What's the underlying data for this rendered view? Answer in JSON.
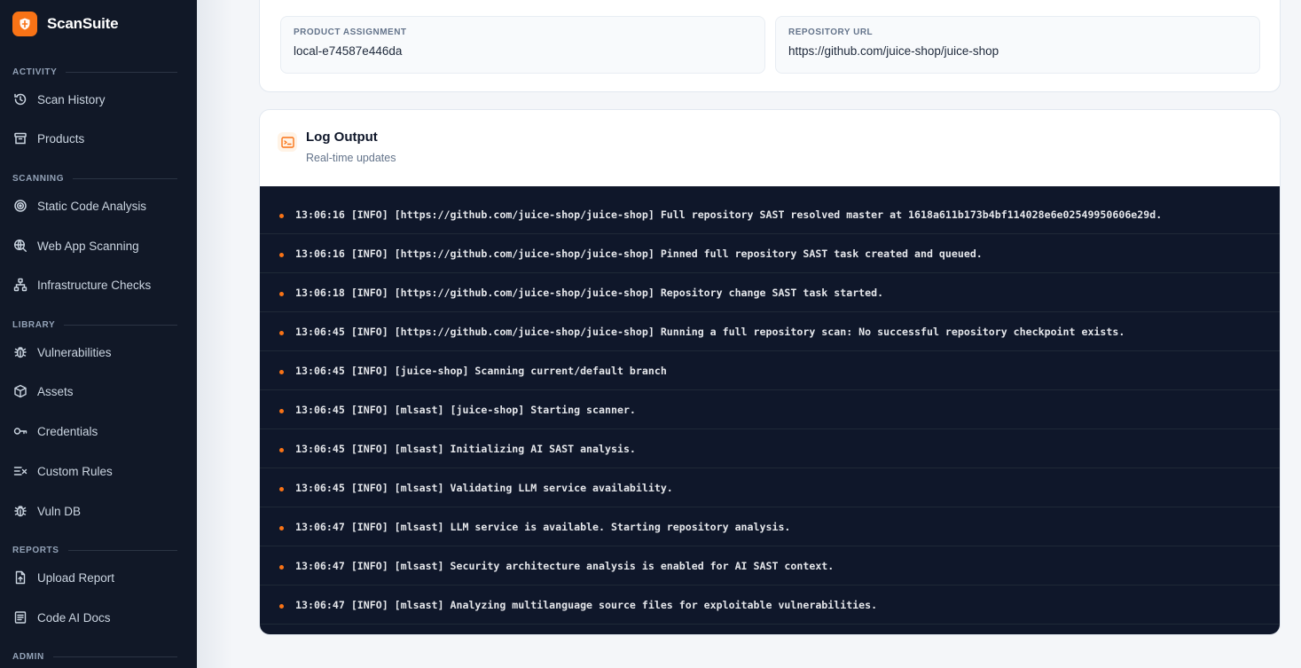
{
  "app": {
    "name": "ScanSuite"
  },
  "sidebar": {
    "sections": [
      {
        "title": "ACTIVITY",
        "items": [
          {
            "label": "Scan History",
            "icon": "history-icon"
          },
          {
            "label": "Products",
            "icon": "archive-icon"
          }
        ]
      },
      {
        "title": "SCANNING",
        "items": [
          {
            "label": "Static Code Analysis",
            "icon": "target-icon"
          },
          {
            "label": "Web App Scanning",
            "icon": "globe-search-icon"
          },
          {
            "label": "Infrastructure Checks",
            "icon": "network-icon"
          }
        ]
      },
      {
        "title": "LIBRARY",
        "items": [
          {
            "label": "Vulnerabilities",
            "icon": "bug-icon"
          },
          {
            "label": "Assets",
            "icon": "box-icon"
          },
          {
            "label": "Credentials",
            "icon": "key-icon"
          },
          {
            "label": "Custom Rules",
            "icon": "list-x-icon"
          },
          {
            "label": "Vuln DB",
            "icon": "bug-icon"
          }
        ]
      },
      {
        "title": "REPORTS",
        "items": [
          {
            "label": "Upload Report",
            "icon": "file-upload-icon"
          },
          {
            "label": "Code AI Docs",
            "icon": "document-icon"
          }
        ]
      },
      {
        "title": "ADMIN",
        "items": []
      }
    ]
  },
  "details": {
    "product_assignment": {
      "label": "PRODUCT ASSIGNMENT",
      "value": "local-e74587e446da"
    },
    "repository_url": {
      "label": "REPOSITORY URL",
      "value": "https://github.com/juice-shop/juice-shop"
    }
  },
  "log": {
    "title": "Log Output",
    "subtitle": "Real-time updates",
    "icon": "terminal-icon",
    "accent": "#f97316",
    "lines": [
      "13:06:16 [INFO] [https://github.com/juice-shop/juice-shop] Full repository SAST resolved master at 1618a611b173b4bf114028e6e02549950606e29d.",
      "13:06:16 [INFO] [https://github.com/juice-shop/juice-shop] Pinned full repository SAST task created and queued.",
      "13:06:18 [INFO] [https://github.com/juice-shop/juice-shop] Repository change SAST task started.",
      "13:06:45 [INFO] [https://github.com/juice-shop/juice-shop] Running a full repository scan: No successful repository checkpoint exists.",
      "13:06:45 [INFO] [juice-shop] Scanning current/default branch",
      "13:06:45 [INFO] [mlsast] [juice-shop] Starting scanner.",
      "13:06:45 [INFO] [mlsast] Initializing AI SAST analysis.",
      "13:06:45 [INFO] [mlsast] Validating LLM service availability.",
      "13:06:47 [INFO] [mlsast] LLM service is available. Starting repository analysis.",
      "13:06:47 [INFO] [mlsast] Security architecture analysis is enabled for AI SAST context.",
      "13:06:47 [INFO] [mlsast] Analyzing multilanguage source files for exploitable vulnerabilities."
    ]
  }
}
